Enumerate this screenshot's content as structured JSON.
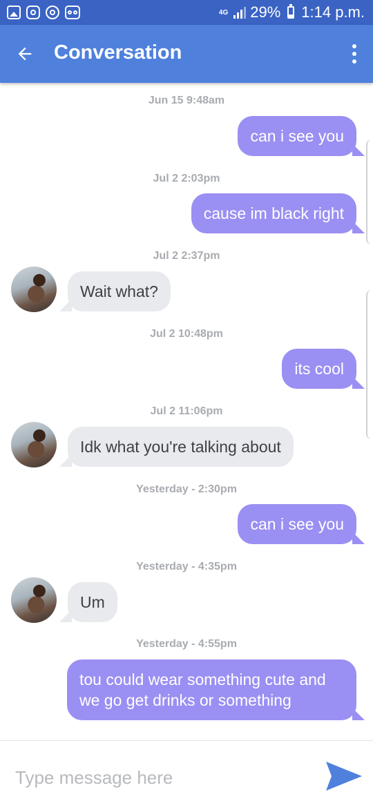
{
  "status_bar": {
    "network": "4G",
    "battery": "29%",
    "battery_level": 0.29,
    "time": "1:14 p.m.",
    "left_icons": [
      "gallery-icon",
      "instagram-icon",
      "target-icon",
      "voicemail-icon"
    ]
  },
  "header": {
    "title": "Conversation",
    "background": "#4f80dc"
  },
  "messages": [
    {
      "timestamp": "Jun 15 9:48am",
      "direction": "out",
      "text": "can i see you"
    },
    {
      "timestamp": "Jul 2 2:03pm",
      "direction": "out",
      "text": "cause im black right"
    },
    {
      "timestamp": "Jul 2 2:37pm",
      "direction": "in",
      "text": "Wait what?"
    },
    {
      "timestamp": "Jul 2 10:48pm",
      "direction": "out",
      "text": "its cool"
    },
    {
      "timestamp": "Jul 2 11:06pm",
      "direction": "in",
      "text": "Idk what you're talking about"
    },
    {
      "timestamp": "Yesterday - 2:30pm",
      "direction": "out",
      "text": "can i see you"
    },
    {
      "timestamp": "Yesterday - 4:35pm",
      "direction": "in",
      "text": "Um"
    },
    {
      "timestamp": "Yesterday - 4:55pm",
      "direction": "out",
      "text": "tou could wear something cute and we go get drinks or something"
    }
  ],
  "composer": {
    "placeholder": "Type message here",
    "value": ""
  },
  "colors": {
    "status_bar": "#3a63c4",
    "outgoing_bubble": "#9a8ff2",
    "incoming_bubble": "#e8eaed",
    "send_icon": "#4f80dc"
  }
}
